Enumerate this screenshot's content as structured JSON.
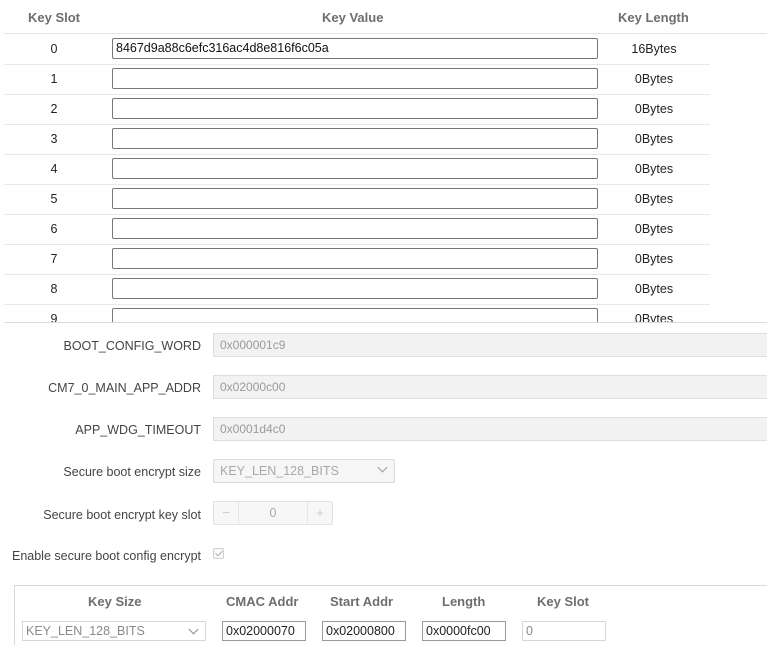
{
  "key_table": {
    "headers": {
      "slot": "Key Slot",
      "value": "Key Value",
      "length": "Key Length"
    },
    "rows": [
      {
        "slot": "0",
        "value": "8467d9a88c6efc316ac4d8e816f6c05a",
        "length": "16Bytes"
      },
      {
        "slot": "1",
        "value": "",
        "length": "0Bytes"
      },
      {
        "slot": "2",
        "value": "",
        "length": "0Bytes"
      },
      {
        "slot": "3",
        "value": "",
        "length": "0Bytes"
      },
      {
        "slot": "4",
        "value": "",
        "length": "0Bytes"
      },
      {
        "slot": "5",
        "value": "",
        "length": "0Bytes"
      },
      {
        "slot": "6",
        "value": "",
        "length": "0Bytes"
      },
      {
        "slot": "7",
        "value": "",
        "length": "0Bytes"
      },
      {
        "slot": "8",
        "value": "",
        "length": "0Bytes"
      },
      {
        "slot": "9",
        "value": "",
        "length": "0Bytes"
      }
    ]
  },
  "form": {
    "boot_config_word": {
      "label": "BOOT_CONFIG_WORD",
      "value": "0x000001c9"
    },
    "cm7_main_app_addr": {
      "label": "CM7_0_MAIN_APP_ADDR",
      "value": "0x02000c00"
    },
    "app_wdg_timeout": {
      "label": "APP_WDG_TIMEOUT",
      "value": "0x0001d4c0"
    },
    "encrypt_size": {
      "label": "Secure boot encrypt size",
      "value": "KEY_LEN_128_BITS"
    },
    "encrypt_key_slot": {
      "label": "Secure boot encrypt key slot",
      "value": "0",
      "dec": "−",
      "inc": "+"
    },
    "enable_encrypt": {
      "label": "Enable secure boot config encrypt",
      "checked": true
    }
  },
  "cmac_table": {
    "headers": {
      "key_size": "Key Size",
      "cmac_addr": "CMAC Addr",
      "start_addr": "Start Addr",
      "length": "Length",
      "key_slot": "Key Slot"
    },
    "row": {
      "key_size": "KEY_LEN_128_BITS",
      "cmac_addr": "0x02000070",
      "start_addr": "0x02000800",
      "length": "0x0000fc00",
      "key_slot": "0"
    }
  },
  "icons": {
    "dropdown": "chevron-down-icon",
    "checkbox": "checkmark-icon"
  }
}
